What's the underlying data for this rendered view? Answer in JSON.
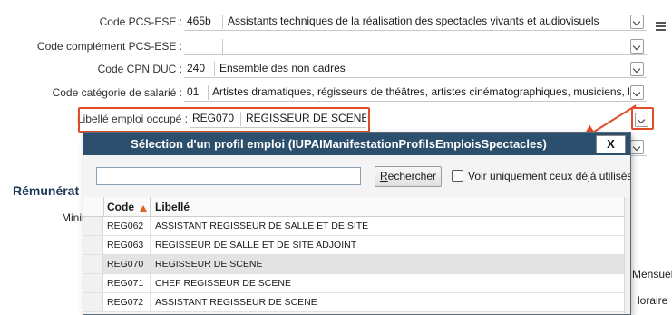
{
  "form": {
    "pcs_ese": {
      "label": "Code PCS-ESE :",
      "code": "465b",
      "text": "Assistants techniques de la réalisation des spectacles vivants et audiovisuels"
    },
    "pcs_comp": {
      "label": "Code complément PCS-ESE :",
      "code": "",
      "text": ""
    },
    "cpn_duc": {
      "label": "Code CPN DUC :",
      "code": "240",
      "text": "Ensemble des non cadres"
    },
    "cat_salarie": {
      "label": "Code catégorie de salarié :",
      "code": "01",
      "text": "Artistes dramatiques, régisseurs de théâtres, artistes cinématographiques, musiciens, lyriques, chor"
    },
    "emploi": {
      "label": "Libellé emploi occupé :",
      "code": "REG070",
      "text": "REGISSEUR DE SCENE"
    }
  },
  "section": {
    "title": "Rémunérat",
    "min_label": "Minir"
  },
  "right_peek": {
    "mensuel": "Mensuel",
    "horaire": "loraire"
  },
  "dialog": {
    "title": "Sélection d'un profil emploi (IUPAIManifestationProfilsEmploisSpectacles)",
    "close_label": "X",
    "search_value": "",
    "search_button_acc": "R",
    "search_button_rest": "echercher",
    "checkbox_label": "Voir uniquement ceux déjà utilisés",
    "columns": {
      "code": "Code",
      "libelle": "Libellé"
    },
    "rows": [
      {
        "code": "REG062",
        "libelle": "ASSISTANT REGISSEUR DE SALLE ET DE SITE"
      },
      {
        "code": "REG063",
        "libelle": "REGISSEUR DE SALLE ET DE SITE ADJOINT"
      },
      {
        "code": "REG070",
        "libelle": "REGISSEUR DE SCENE"
      },
      {
        "code": "REG071",
        "libelle": "CHEF REGISSEUR DE SCENE"
      },
      {
        "code": "REG072",
        "libelle": "ASSISTANT REGISSEUR DE SCENE"
      }
    ]
  },
  "colors": {
    "accent": "#2c4f6d",
    "highlight": "#e24a28",
    "section": "#1d3a57"
  }
}
